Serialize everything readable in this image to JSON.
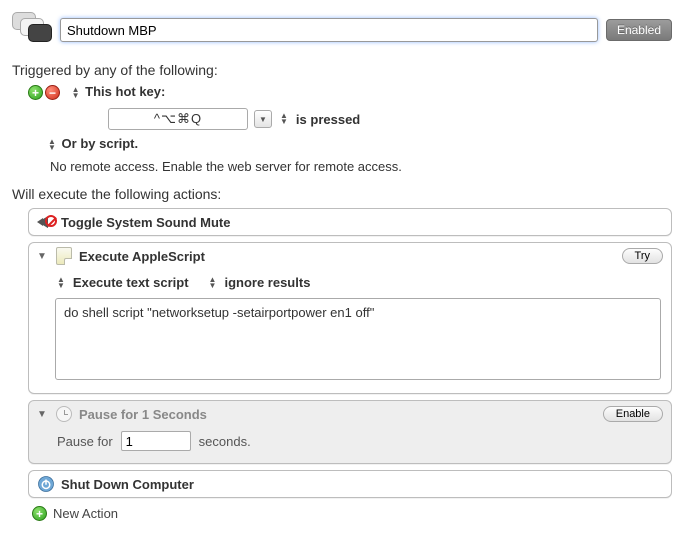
{
  "header": {
    "macro_name": "Shutdown MBP",
    "enabled_button": "Enabled"
  },
  "triggers": {
    "heading": "Triggered by any of the following:",
    "hotkey_label": "This hot key:",
    "hotkey_value": "^⌥⌘Q",
    "pressed_label": "is pressed",
    "script_label": "Or by script.",
    "remote_text": "No remote access.  Enable the web server for remote access."
  },
  "actions": {
    "heading": "Will execute the following actions:",
    "toggle_mute": {
      "title": "Toggle System Sound Mute"
    },
    "applescript": {
      "title": "Execute AppleScript",
      "try_label": "Try",
      "option_script": "Execute text script",
      "option_results": "ignore results",
      "script_text": "do shell script \"networksetup -setairportpower en1 off\""
    },
    "pause": {
      "title": "Pause for 1 Seconds",
      "enable_label": "Enable",
      "prefix": "Pause for",
      "value": "1",
      "suffix": "seconds."
    },
    "shutdown": {
      "title": "Shut Down Computer"
    },
    "new_action_label": "New Action"
  }
}
